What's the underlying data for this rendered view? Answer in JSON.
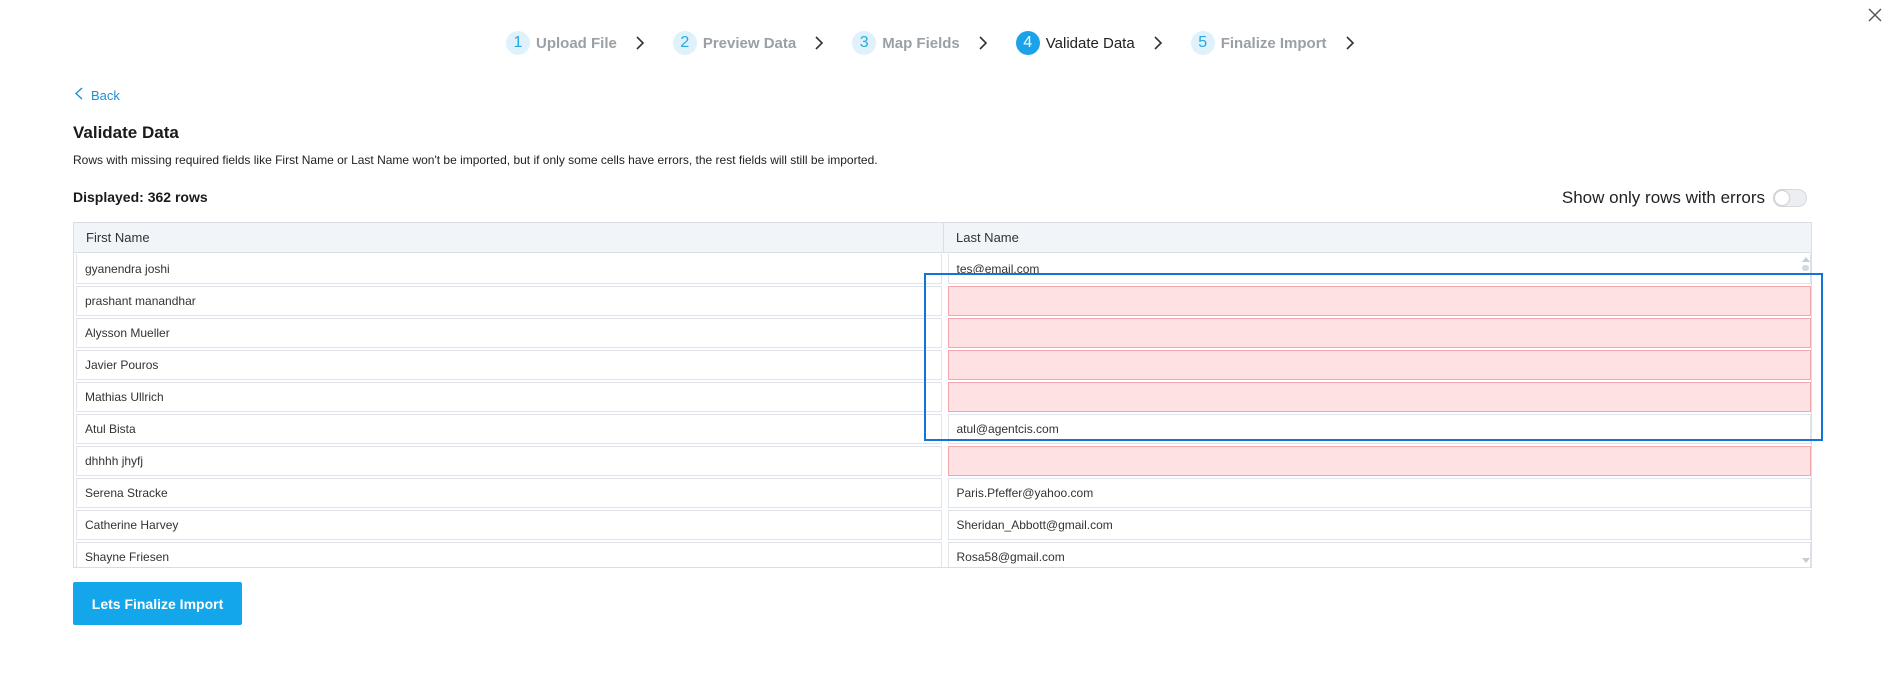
{
  "colors": {
    "accent": "#14a6ea",
    "link": "#1e8fd6",
    "error_cell_bg": "#fee1e3",
    "error_cell_border": "#f3a7ad",
    "selection_box": "#1274d9"
  },
  "stepper": {
    "steps": [
      {
        "number": "1",
        "label": "Upload File",
        "state": "inactive"
      },
      {
        "number": "2",
        "label": "Preview Data",
        "state": "inactive"
      },
      {
        "number": "3",
        "label": "Map Fields",
        "state": "inactive"
      },
      {
        "number": "4",
        "label": "Validate Data",
        "state": "active"
      },
      {
        "number": "5",
        "label": "Finalize Import",
        "state": "inactive"
      }
    ]
  },
  "nav": {
    "back_label": "Back",
    "close_icon": "close-icon"
  },
  "page": {
    "title": "Validate Data",
    "description": "Rows with missing required fields like First Name or Last Name won't be imported, but if only some cells have errors, the rest fields will still be imported.",
    "displayed": "Displayed: 362 rows",
    "toggle_label": "Show only rows with errors",
    "toggle_on": false
  },
  "table": {
    "columns": [
      "First Name",
      "Last Name"
    ],
    "rows": [
      {
        "first": "gyanendra joshi",
        "last": "tes@email.com",
        "error": false
      },
      {
        "first": "prashant manandhar",
        "last": "",
        "error": true
      },
      {
        "first": "Alysson Mueller",
        "last": "",
        "error": true
      },
      {
        "first": "Javier Pouros",
        "last": "",
        "error": true
      },
      {
        "first": "Mathias Ullrich",
        "last": "",
        "error": true
      },
      {
        "first": "Atul Bista",
        "last": "atul@agentcis.com",
        "error": false
      },
      {
        "first": "dhhhh jhyfj",
        "last": "",
        "error": true
      },
      {
        "first": "Serena Stracke",
        "last": "Paris.Pfeffer@yahoo.com",
        "error": false
      },
      {
        "first": "Catherine Harvey",
        "last": "Sheridan_Abbott@gmail.com",
        "error": false
      },
      {
        "first": "Shayne Friesen",
        "last": "Rosa58@gmail.com",
        "error": false
      }
    ]
  },
  "actions": {
    "finalize_label": "Lets Finalize Import"
  }
}
